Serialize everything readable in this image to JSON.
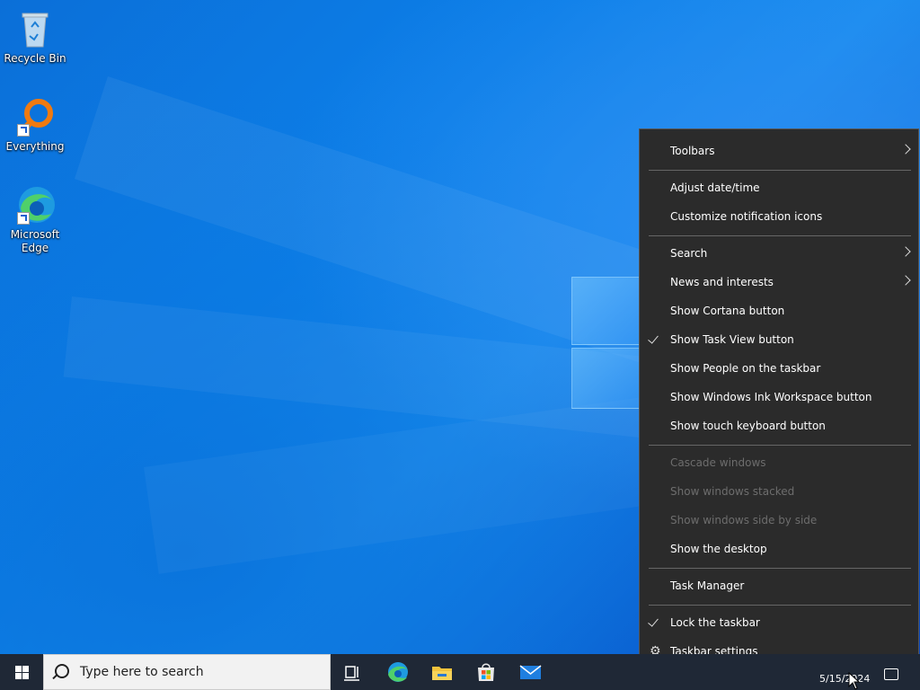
{
  "desktop": {
    "icons": [
      {
        "label": "Recycle Bin",
        "icon": "recycle-bin-icon"
      },
      {
        "label": "Everything",
        "icon": "search-magnifier-icon"
      },
      {
        "label": "Microsoft Edge",
        "icon": "edge-icon"
      }
    ]
  },
  "context_menu": {
    "items": [
      {
        "label": "Toolbars",
        "submenu": true
      },
      {
        "label": "Adjust date/time"
      },
      {
        "label": "Customize notification icons"
      },
      {
        "label": "Search",
        "submenu": true
      },
      {
        "label": "News and interests",
        "submenu": true
      },
      {
        "label": "Show Cortana button"
      },
      {
        "label": "Show Task View button",
        "checked": true
      },
      {
        "label": "Show People on the taskbar"
      },
      {
        "label": "Show Windows Ink Workspace button"
      },
      {
        "label": "Show touch keyboard button"
      },
      {
        "label": "Cascade windows",
        "disabled": true
      },
      {
        "label": "Show windows stacked",
        "disabled": true
      },
      {
        "label": "Show windows side by side",
        "disabled": true
      },
      {
        "label": "Show the desktop"
      },
      {
        "label": "Task Manager"
      },
      {
        "label": "Lock the taskbar",
        "checked": true
      },
      {
        "label": "Taskbar settings",
        "icon": "gear-icon"
      }
    ]
  },
  "taskbar": {
    "search_placeholder": "Type here to search",
    "apps": [
      "task-view-icon",
      "edge-icon",
      "file-explorer-icon",
      "microsoft-store-icon",
      "mail-icon"
    ],
    "clock_date": "5/15/2024"
  },
  "colors": {
    "menu_bg": "#2b2b2b",
    "taskbar_bg": "#1f2836",
    "desktop_blue": "#0c7fe8"
  }
}
